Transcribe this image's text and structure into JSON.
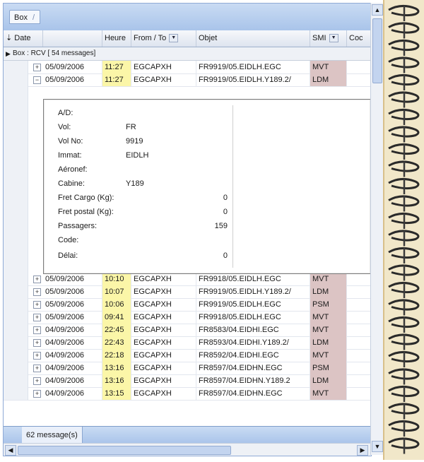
{
  "tab": {
    "label": "Box",
    "close": "/"
  },
  "columns": {
    "pin": "⇣",
    "date": "Date",
    "heure": "Heure",
    "fromto": "From / To",
    "objet": "Objet",
    "smi": "SMI",
    "code": "Coc",
    "dropdown_glyph": "▼"
  },
  "group": {
    "expander": "▶",
    "label": "Box : RCV [ 54 messages]"
  },
  "rows_top": [
    {
      "exp": "+",
      "date": "05/09/2006",
      "time": "11:27",
      "from": "EGCAPXH",
      "obj": "FR9919/05.EIDLH.EGC",
      "smi": "MVT"
    },
    {
      "exp": "−",
      "date": "05/09/2006",
      "time": "11:27",
      "from": "EGCAPXH",
      "obj": "FR9919/05.EIDLH.Y189.2/",
      "smi": "LDM"
    }
  ],
  "detail": {
    "fields": [
      {
        "label": "A/D:",
        "value": "",
        "num": ""
      },
      {
        "label": "Vol:",
        "value": "FR",
        "num": ""
      },
      {
        "label": "Vol No:",
        "value": "9919",
        "num": ""
      },
      {
        "label": "Immat:",
        "value": "EIDLH",
        "num": ""
      },
      {
        "label": "Aéronef:",
        "value": "",
        "num": ""
      },
      {
        "label": "Cabine:",
        "value": "Y189",
        "num": ""
      },
      {
        "label": "Fret Cargo (Kg):",
        "value": "",
        "num": "0"
      },
      {
        "label": "Fret postal (Kg):",
        "value": "",
        "num": "0"
      },
      {
        "label": "Passagers:",
        "value": "",
        "num": "159"
      },
      {
        "label": "Code:",
        "value": "",
        "num": ""
      },
      {
        "label": "Délai:",
        "value": "",
        "num": "0"
      }
    ]
  },
  "rows_bottom": [
    {
      "exp": "+",
      "date": "05/09/2006",
      "time": "10:10",
      "from": "EGCAPXH",
      "obj": "FR9918/05.EIDLH.EGC",
      "smi": "MVT"
    },
    {
      "exp": "+",
      "date": "05/09/2006",
      "time": "10:07",
      "from": "EGCAPXH",
      "obj": "FR9919/05.EIDLH.Y189.2/",
      "smi": "LDM"
    },
    {
      "exp": "+",
      "date": "05/09/2006",
      "time": "10:06",
      "from": "EGCAPXH",
      "obj": "FR9919/05.EIDLH.EGC",
      "smi": "PSM"
    },
    {
      "exp": "+",
      "date": "05/09/2006",
      "time": "09:41",
      "from": "EGCAPXH",
      "obj": "FR9918/05.EIDLH.EGC",
      "smi": "MVT"
    },
    {
      "exp": "+",
      "date": "04/09/2006",
      "time": "22:45",
      "from": "EGCAPXH",
      "obj": "FR8583/04.EIDHI.EGC",
      "smi": "MVT"
    },
    {
      "exp": "+",
      "date": "04/09/2006",
      "time": "22:43",
      "from": "EGCAPXH",
      "obj": "FR8593/04.EIDHI.Y189.2/",
      "smi": "LDM"
    },
    {
      "exp": "+",
      "date": "04/09/2006",
      "time": "22:18",
      "from": "EGCAPXH",
      "obj": "FR8592/04.EIDHI.EGC",
      "smi": "MVT"
    },
    {
      "exp": "+",
      "date": "04/09/2006",
      "time": "13:16",
      "from": "EGCAPXH",
      "obj": "FR8597/04.EIDHN.EGC",
      "smi": "PSM"
    },
    {
      "exp": "+",
      "date": "04/09/2006",
      "time": "13:16",
      "from": "EGCAPXH",
      "obj": "FR8597/04.EIDHN.Y189.2",
      "smi": "LDM"
    },
    {
      "exp": "+",
      "date": "04/09/2006",
      "time": "13:15",
      "from": "EGCAPXH",
      "obj": "FR8597/04.EIDHN.EGC",
      "smi": "MVT"
    }
  ],
  "status": {
    "text": "62 message(s)"
  },
  "scroll": {
    "up": "▲",
    "down": "▼",
    "left": "◀",
    "right": "▶"
  },
  "icons": {
    "spiral": "notebook-spiral-icon"
  },
  "colors": {
    "time_bg": "#fbf6a8",
    "smi_bg": "#dcc4c4",
    "frame": "#a9c4ea"
  }
}
